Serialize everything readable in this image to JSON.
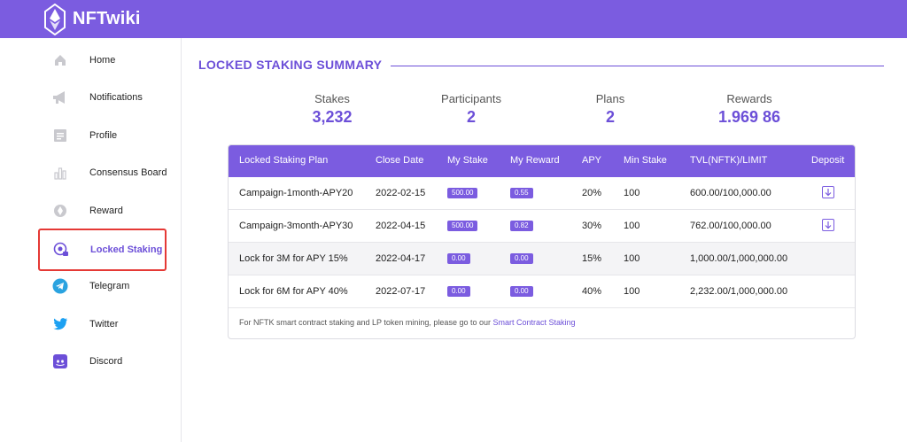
{
  "app": {
    "name": "NFTwiki"
  },
  "sidebar": {
    "items": [
      {
        "label": "Home",
        "icon": "home-icon"
      },
      {
        "label": "Notifications",
        "icon": "megaphone-icon"
      },
      {
        "label": "Profile",
        "icon": "profile-card-icon"
      },
      {
        "label": "Consensus Board",
        "icon": "bar-chart-icon"
      },
      {
        "label": "Reward",
        "icon": "ethereum-icon"
      },
      {
        "label": "Locked Staking",
        "icon": "locked-staking-icon",
        "active": true
      },
      {
        "label": "Telegram",
        "icon": "telegram-icon"
      },
      {
        "label": "Twitter",
        "icon": "twitter-icon"
      },
      {
        "label": "Discord",
        "icon": "discord-icon"
      }
    ]
  },
  "summary": {
    "title": "LOCKED STAKING SUMMARY",
    "stats": [
      {
        "label": "Stakes",
        "value": "3,232"
      },
      {
        "label": "Participants",
        "value": "2"
      },
      {
        "label": "Plans",
        "value": "2"
      },
      {
        "label": "Rewards",
        "value": "1.969 86"
      }
    ]
  },
  "table": {
    "headers": [
      "Locked Staking Plan",
      "Close Date",
      "My Stake",
      "My Reward",
      "APY",
      "Min Stake",
      "TVL(NFTK)/LIMIT",
      "Deposit"
    ],
    "rows": [
      {
        "plan": "Campaign-1month-APY20",
        "close_date": "2022-02-15",
        "my_stake": "500.00",
        "my_reward": "0.55",
        "apy": "20%",
        "min_stake": "100",
        "tvl": "600.00/100,000.00",
        "deposit": true
      },
      {
        "plan": "Campaign-3month-APY30",
        "close_date": "2022-04-15",
        "my_stake": "500.00",
        "my_reward": "0.82",
        "apy": "30%",
        "min_stake": "100",
        "tvl": "762.00/100,000.00",
        "deposit": true
      },
      {
        "plan": "Lock for 3M for APY 15%",
        "close_date": "2022-04-17",
        "my_stake": "0.00",
        "my_reward": "0.00",
        "apy": "15%",
        "min_stake": "100",
        "tvl": "1,000.00/1,000,000.00",
        "deposit": false
      },
      {
        "plan": "Lock for 6M for APY 40%",
        "close_date": "2022-07-17",
        "my_stake": "0.00",
        "my_reward": "0.00",
        "apy": "40%",
        "min_stake": "100",
        "tvl": "2,232.00/1,000,000.00",
        "deposit": false
      }
    ],
    "footer_text": "For NFTK smart contract staking and LP token mining, please go to our ",
    "footer_link": "Smart Contract Staking"
  },
  "colors": {
    "brand": "#7b5ce0",
    "accent_text": "#6c4fd8",
    "highlight_border": "#e53935"
  }
}
